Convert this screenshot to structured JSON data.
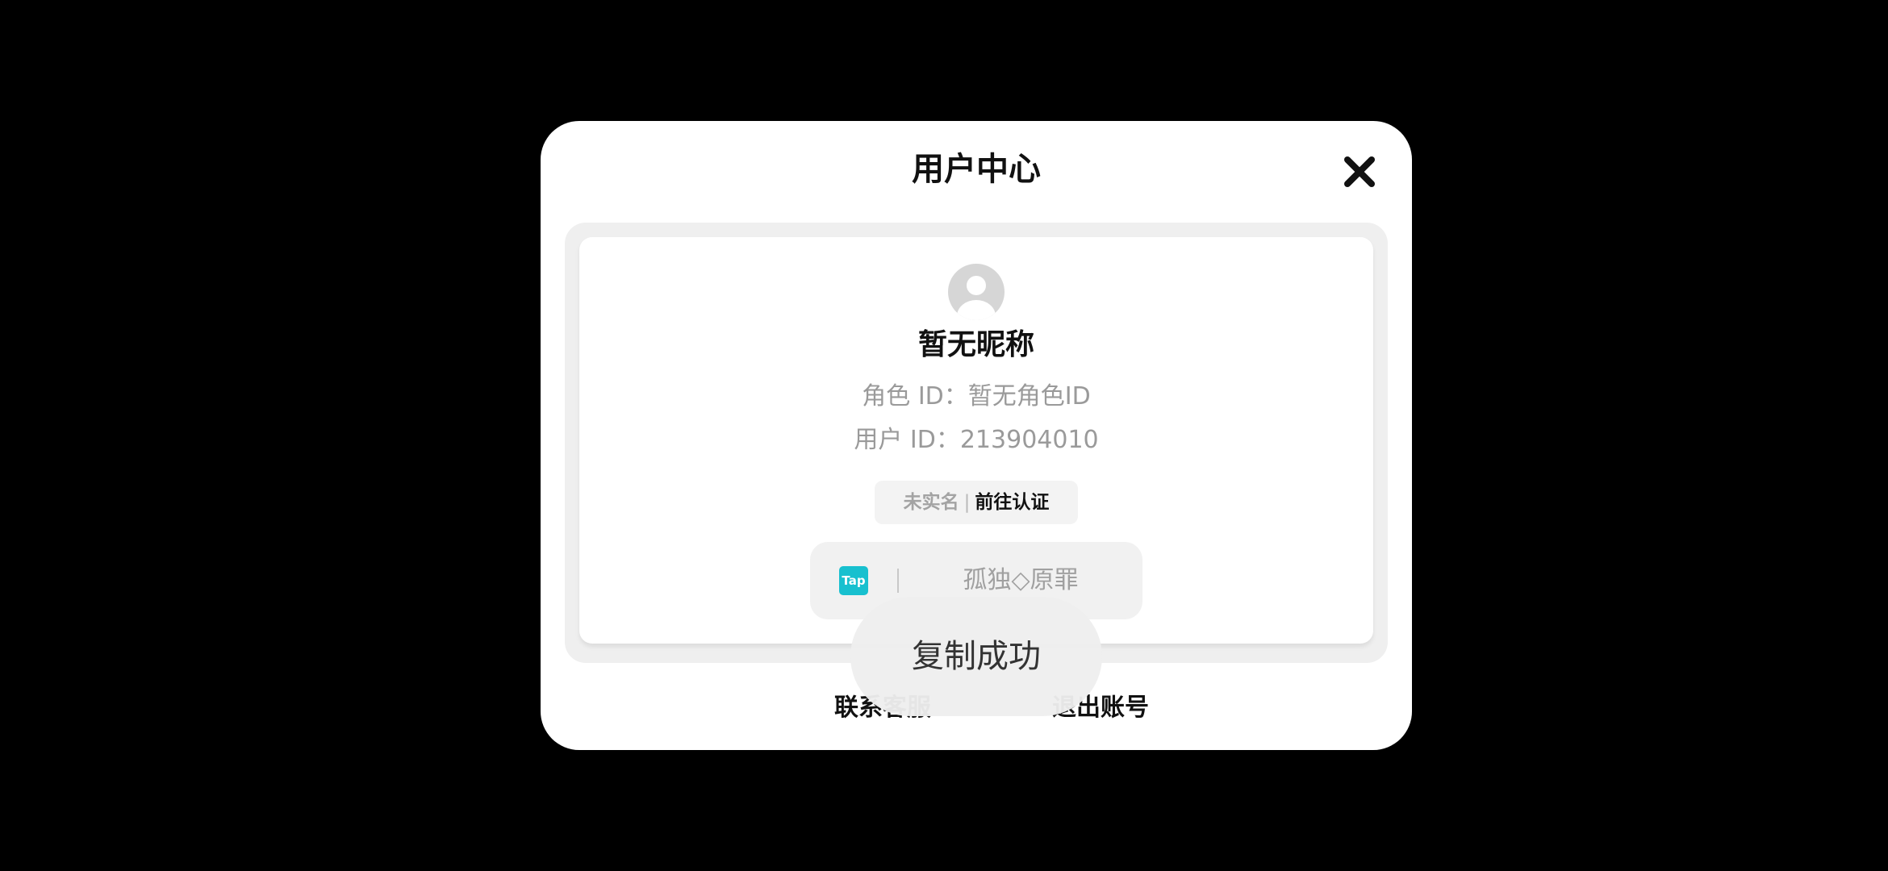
{
  "dialog": {
    "title": "用户中心"
  },
  "profile": {
    "nickname": "暂无昵称",
    "role_id_line": "角色 ID：暂无角色ID",
    "user_id_line": "用户 ID：213904010",
    "realname_status": "未实名",
    "realname_separator": "|",
    "realname_action": "前往认证"
  },
  "linked_account": {
    "platform_logo_text": "Tap",
    "name": "孤独◇原罪"
  },
  "footer": {
    "contact_label": "联系客服",
    "logout_label": "退出账号"
  },
  "toast": {
    "message": "复制成功"
  },
  "icons": {
    "close": "close-icon",
    "avatar": "avatar-icon",
    "platform": "taptap-logo"
  },
  "colors": {
    "background": "#000000",
    "dialog": "#ffffff",
    "card_border": "#efefef",
    "muted_text": "#9a9a9a",
    "tap_brand": "#18c0cf"
  }
}
